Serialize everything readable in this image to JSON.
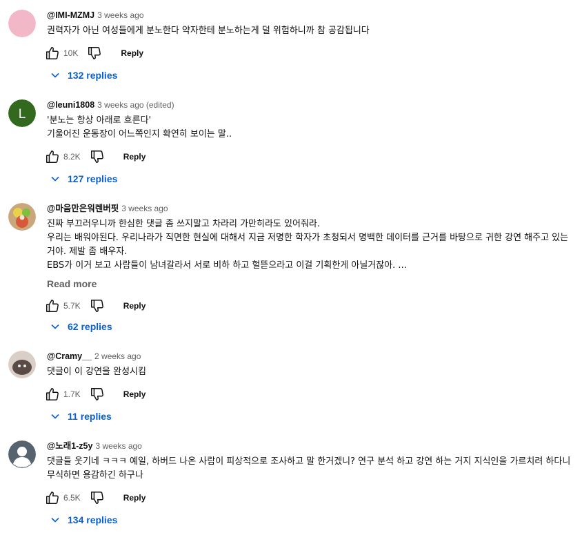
{
  "colors": {
    "link_blue": "#065fd4",
    "muted": "#606060",
    "text": "#0f0f0f"
  },
  "comments": [
    {
      "author": "@IMI-MZMJ",
      "time": "3 weeks ago",
      "text": "권력자가 아닌 여성들에게 분노한다 약자한테 분노하는게 덜 위험하니까 참 공감됩니다",
      "likes": "10K",
      "reply_label": "Reply",
      "replies": "132 replies",
      "avatar": "pink-circle-avatar"
    },
    {
      "author": "@leuni1808",
      "time": "3 weeks ago (edited)",
      "text": "'분노는 항상 아래로 흐른다'\n기울어진 운동장이 어느쪽인지 확연히 보이는 말..",
      "likes": "8.2K",
      "reply_label": "Reply",
      "replies": "127 replies",
      "avatar_letter": "L"
    },
    {
      "author": "@마음만은워렌버핏",
      "time": "3 weeks ago",
      "text": "진짜 부끄러우니까 한심한 댓글 좀 쓰지말고 차라리 가만히라도 있어줘라.\n우리는 배워야된다. 우리나라가 직면한 현실에 대해서 지금 저명한 학자가 초청되서 명백한 데이터를 근거를 바탕으로 귀한 강연 해주고 있는거야. 제발 좀 배우자.\nEBS가 이거 보고 사람들이 남녀갈라서 서로 비하 하고 헐뜯으라고 이걸 기획한게 아닐거잖아. ...",
      "read_more": "Read more",
      "likes": "5.7K",
      "reply_label": "Reply",
      "replies": "62 replies",
      "avatar": "photo-avatar"
    },
    {
      "author": "@Cramy__",
      "time": "2 weeks ago",
      "text": "댓글이 이 강연을 완성시킴",
      "likes": "1.7K",
      "reply_label": "Reply",
      "replies": "11 replies",
      "avatar": "photo-avatar"
    },
    {
      "author": "@노래1-z5y",
      "time": "3 weeks ago",
      "text": "댓글들 웃기네 ㅋㅋㅋ 예일, 하버드 나온 사람이 피상적으로 조사하고 말 한거겠니? 연구 분석 하고 강연 하는 거지 지식인을 가르치려 하다니 무식하면 용감하긴 하구나",
      "likes": "6.5K",
      "reply_label": "Reply",
      "replies": "134 replies",
      "avatar": "default-user-avatar"
    }
  ]
}
